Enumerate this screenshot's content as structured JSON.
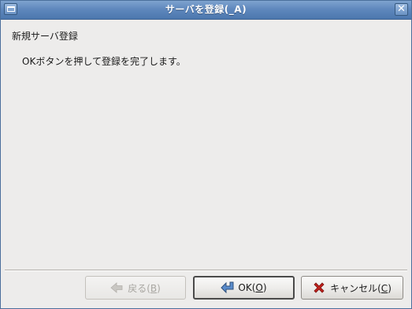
{
  "window": {
    "title": "サーバを登録(_A)"
  },
  "content": {
    "heading": "新規サーバ登録",
    "message": "OKボタンを押して登録を完了します。"
  },
  "buttons": {
    "back": {
      "label": "戻る(",
      "mnemonic": "B",
      "suffix": ")",
      "enabled": false
    },
    "ok": {
      "label": "OK(",
      "mnemonic": "O",
      "suffix": ")",
      "enabled": true
    },
    "cancel": {
      "label": "キャンセル(",
      "mnemonic": "C",
      "suffix": ")",
      "enabled": true
    }
  },
  "icons": {
    "menu": "window-menu-icon",
    "close": "close-icon",
    "back": "back-arrow-icon",
    "ok": "enter-arrow-icon",
    "cancel": "cancel-x-icon"
  },
  "colors": {
    "titlebar": "#5f88bd",
    "background": "#edeceb",
    "cancel_icon": "#c0201b",
    "ok_icon": "#3465a4"
  }
}
